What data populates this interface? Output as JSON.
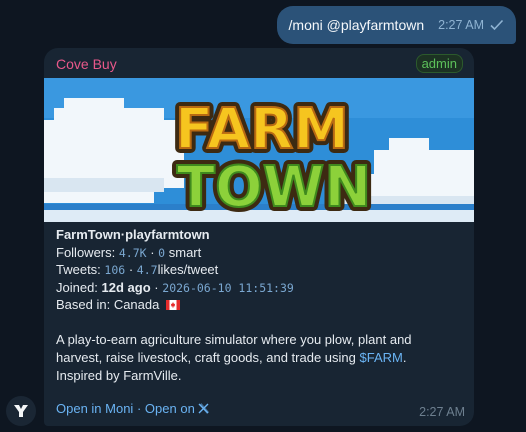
{
  "outgoing": {
    "text": "/moni @playfarmtown",
    "time": "2:27 AM",
    "status_icon": "double-check-icon"
  },
  "message": {
    "sender": "Cove Buy",
    "badge": "admin",
    "banner": {
      "line1": "FARM",
      "line2": "TOWN"
    },
    "account_name": "FarmTown",
    "separator": "·",
    "handle": "playfarmtown",
    "followers_label": "Followers:",
    "followers_value": "4.7K",
    "dot1": "·",
    "smart_value": "0",
    "smart_label": "smart",
    "tweets_label": "Tweets:",
    "tweets_value": "106",
    "dot2": "·",
    "rate_value": "4.7",
    "rate_label": "likes/tweet",
    "joined_label": "Joined:",
    "joined_ago": "12d ago",
    "dot3": "·",
    "joined_date": "2026-06-10 11:51:39",
    "based_label": "Based in: Canada",
    "description_before": "A play-to-earn agriculture simulator where you plow, plant and harvest, raise livestock, craft goods, and trade using ",
    "ticker": "$FARM",
    "description_after": ". Inspired by FarmVille.",
    "link_moni": "Open in Moni",
    "link_sep": "·",
    "link_x": "Open on",
    "time": "2:27 AM"
  },
  "colors": {
    "background": "#0e1621",
    "outgoing_bubble": "#2b5278",
    "incoming_bubble": "#182533",
    "sender_name": "#e8588a",
    "admin_badge": "#5cc05a",
    "link": "#6ab3f3"
  }
}
